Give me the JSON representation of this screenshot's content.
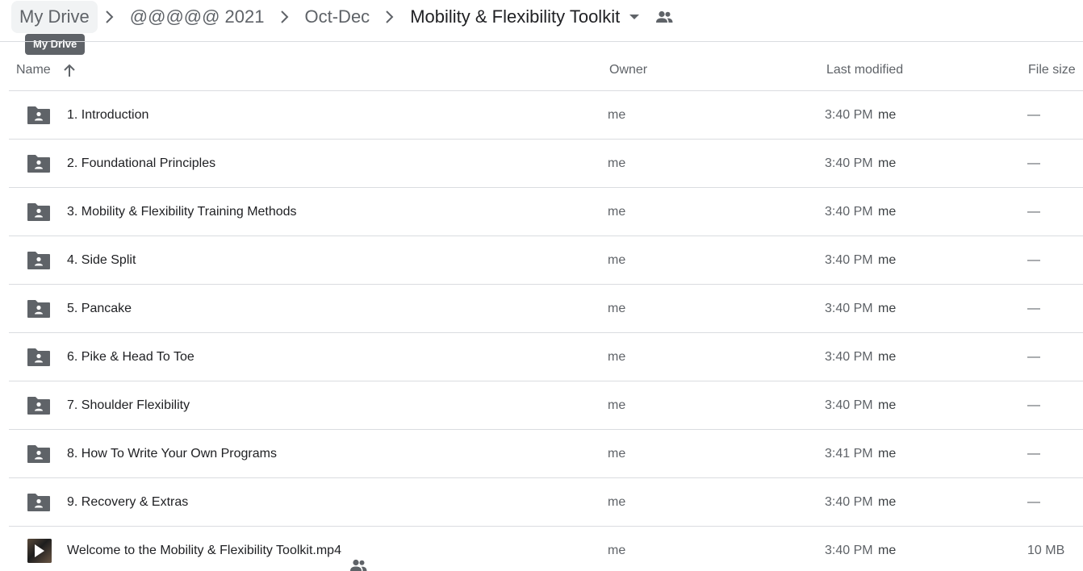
{
  "breadcrumb": {
    "items": [
      {
        "label": "My Drive"
      },
      {
        "label": "@@@@@ 2021"
      },
      {
        "label": "Oct-Dec"
      },
      {
        "label": "Mobility & Flexibility Toolkit"
      }
    ],
    "tooltip": "My Drive"
  },
  "columns": {
    "name": "Name",
    "owner": "Owner",
    "last_modified": "Last modified",
    "file_size": "File size"
  },
  "rows": [
    {
      "name": "1. Introduction",
      "type": "shared-folder-icon",
      "owner": "me",
      "time": "3:40 PM",
      "modified_by": "me",
      "size": "—"
    },
    {
      "name": "2. Foundational Principles",
      "type": "shared-folder-icon",
      "owner": "me",
      "time": "3:40 PM",
      "modified_by": "me",
      "size": "—"
    },
    {
      "name": "3. Mobility & Flexibility Training Methods",
      "type": "shared-folder-icon",
      "owner": "me",
      "time": "3:40 PM",
      "modified_by": "me",
      "size": "—"
    },
    {
      "name": "4. Side Split",
      "type": "shared-folder-icon",
      "owner": "me",
      "time": "3:40 PM",
      "modified_by": "me",
      "size": "—"
    },
    {
      "name": "5. Pancake",
      "type": "shared-folder-icon",
      "owner": "me",
      "time": "3:40 PM",
      "modified_by": "me",
      "size": "—"
    },
    {
      "name": "6. Pike & Head To Toe",
      "type": "shared-folder-icon",
      "owner": "me",
      "time": "3:40 PM",
      "modified_by": "me",
      "size": "—"
    },
    {
      "name": "7. Shoulder Flexibility",
      "type": "shared-folder-icon",
      "owner": "me",
      "time": "3:40 PM",
      "modified_by": "me",
      "size": "—"
    },
    {
      "name": "8. How To Write Your Own Programs",
      "type": "shared-folder-icon",
      "owner": "me",
      "time": "3:41 PM",
      "modified_by": "me",
      "size": "—"
    },
    {
      "name": "9. Recovery & Extras",
      "type": "shared-folder-icon",
      "owner": "me",
      "time": "3:40 PM",
      "modified_by": "me",
      "size": "—"
    },
    {
      "name": "Welcome to the Mobility & Flexibility Toolkit.mp4",
      "type": "video-thumbnail-icon",
      "shared": true,
      "owner": "me",
      "time": "3:40 PM",
      "modified_by": "me",
      "size": "10 MB"
    }
  ],
  "colors": {
    "text_primary": "#202124",
    "text_secondary": "#5f6368",
    "divider": "#dadce0",
    "tooltip_bg": "#5f6368",
    "chip_bg": "#f1f3f4"
  }
}
